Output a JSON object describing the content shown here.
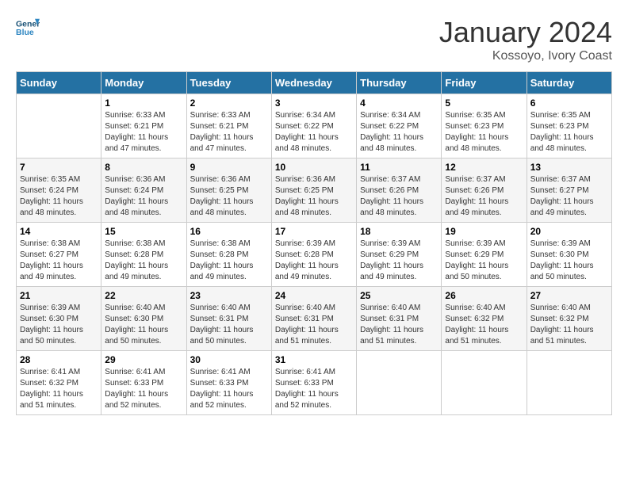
{
  "header": {
    "logo_line1": "General",
    "logo_line2": "Blue",
    "title": "January 2024",
    "subtitle": "Kossoyo, Ivory Coast"
  },
  "weekdays": [
    "Sunday",
    "Monday",
    "Tuesday",
    "Wednesday",
    "Thursday",
    "Friday",
    "Saturday"
  ],
  "weeks": [
    [
      {
        "day": "",
        "sunrise": "",
        "sunset": "",
        "daylight": ""
      },
      {
        "day": "1",
        "sunrise": "Sunrise: 6:33 AM",
        "sunset": "Sunset: 6:21 PM",
        "daylight": "Daylight: 11 hours and 47 minutes."
      },
      {
        "day": "2",
        "sunrise": "Sunrise: 6:33 AM",
        "sunset": "Sunset: 6:21 PM",
        "daylight": "Daylight: 11 hours and 47 minutes."
      },
      {
        "day": "3",
        "sunrise": "Sunrise: 6:34 AM",
        "sunset": "Sunset: 6:22 PM",
        "daylight": "Daylight: 11 hours and 48 minutes."
      },
      {
        "day": "4",
        "sunrise": "Sunrise: 6:34 AM",
        "sunset": "Sunset: 6:22 PM",
        "daylight": "Daylight: 11 hours and 48 minutes."
      },
      {
        "day": "5",
        "sunrise": "Sunrise: 6:35 AM",
        "sunset": "Sunset: 6:23 PM",
        "daylight": "Daylight: 11 hours and 48 minutes."
      },
      {
        "day": "6",
        "sunrise": "Sunrise: 6:35 AM",
        "sunset": "Sunset: 6:23 PM",
        "daylight": "Daylight: 11 hours and 48 minutes."
      }
    ],
    [
      {
        "day": "7",
        "sunrise": "Sunrise: 6:35 AM",
        "sunset": "Sunset: 6:24 PM",
        "daylight": "Daylight: 11 hours and 48 minutes."
      },
      {
        "day": "8",
        "sunrise": "Sunrise: 6:36 AM",
        "sunset": "Sunset: 6:24 PM",
        "daylight": "Daylight: 11 hours and 48 minutes."
      },
      {
        "day": "9",
        "sunrise": "Sunrise: 6:36 AM",
        "sunset": "Sunset: 6:25 PM",
        "daylight": "Daylight: 11 hours and 48 minutes."
      },
      {
        "day": "10",
        "sunrise": "Sunrise: 6:36 AM",
        "sunset": "Sunset: 6:25 PM",
        "daylight": "Daylight: 11 hours and 48 minutes."
      },
      {
        "day": "11",
        "sunrise": "Sunrise: 6:37 AM",
        "sunset": "Sunset: 6:26 PM",
        "daylight": "Daylight: 11 hours and 48 minutes."
      },
      {
        "day": "12",
        "sunrise": "Sunrise: 6:37 AM",
        "sunset": "Sunset: 6:26 PM",
        "daylight": "Daylight: 11 hours and 49 minutes."
      },
      {
        "day": "13",
        "sunrise": "Sunrise: 6:37 AM",
        "sunset": "Sunset: 6:27 PM",
        "daylight": "Daylight: 11 hours and 49 minutes."
      }
    ],
    [
      {
        "day": "14",
        "sunrise": "Sunrise: 6:38 AM",
        "sunset": "Sunset: 6:27 PM",
        "daylight": "Daylight: 11 hours and 49 minutes."
      },
      {
        "day": "15",
        "sunrise": "Sunrise: 6:38 AM",
        "sunset": "Sunset: 6:28 PM",
        "daylight": "Daylight: 11 hours and 49 minutes."
      },
      {
        "day": "16",
        "sunrise": "Sunrise: 6:38 AM",
        "sunset": "Sunset: 6:28 PM",
        "daylight": "Daylight: 11 hours and 49 minutes."
      },
      {
        "day": "17",
        "sunrise": "Sunrise: 6:39 AM",
        "sunset": "Sunset: 6:28 PM",
        "daylight": "Daylight: 11 hours and 49 minutes."
      },
      {
        "day": "18",
        "sunrise": "Sunrise: 6:39 AM",
        "sunset": "Sunset: 6:29 PM",
        "daylight": "Daylight: 11 hours and 49 minutes."
      },
      {
        "day": "19",
        "sunrise": "Sunrise: 6:39 AM",
        "sunset": "Sunset: 6:29 PM",
        "daylight": "Daylight: 11 hours and 50 minutes."
      },
      {
        "day": "20",
        "sunrise": "Sunrise: 6:39 AM",
        "sunset": "Sunset: 6:30 PM",
        "daylight": "Daylight: 11 hours and 50 minutes."
      }
    ],
    [
      {
        "day": "21",
        "sunrise": "Sunrise: 6:39 AM",
        "sunset": "Sunset: 6:30 PM",
        "daylight": "Daylight: 11 hours and 50 minutes."
      },
      {
        "day": "22",
        "sunrise": "Sunrise: 6:40 AM",
        "sunset": "Sunset: 6:30 PM",
        "daylight": "Daylight: 11 hours and 50 minutes."
      },
      {
        "day": "23",
        "sunrise": "Sunrise: 6:40 AM",
        "sunset": "Sunset: 6:31 PM",
        "daylight": "Daylight: 11 hours and 50 minutes."
      },
      {
        "day": "24",
        "sunrise": "Sunrise: 6:40 AM",
        "sunset": "Sunset: 6:31 PM",
        "daylight": "Daylight: 11 hours and 51 minutes."
      },
      {
        "day": "25",
        "sunrise": "Sunrise: 6:40 AM",
        "sunset": "Sunset: 6:31 PM",
        "daylight": "Daylight: 11 hours and 51 minutes."
      },
      {
        "day": "26",
        "sunrise": "Sunrise: 6:40 AM",
        "sunset": "Sunset: 6:32 PM",
        "daylight": "Daylight: 11 hours and 51 minutes."
      },
      {
        "day": "27",
        "sunrise": "Sunrise: 6:40 AM",
        "sunset": "Sunset: 6:32 PM",
        "daylight": "Daylight: 11 hours and 51 minutes."
      }
    ],
    [
      {
        "day": "28",
        "sunrise": "Sunrise: 6:41 AM",
        "sunset": "Sunset: 6:32 PM",
        "daylight": "Daylight: 11 hours and 51 minutes."
      },
      {
        "day": "29",
        "sunrise": "Sunrise: 6:41 AM",
        "sunset": "Sunset: 6:33 PM",
        "daylight": "Daylight: 11 hours and 52 minutes."
      },
      {
        "day": "30",
        "sunrise": "Sunrise: 6:41 AM",
        "sunset": "Sunset: 6:33 PM",
        "daylight": "Daylight: 11 hours and 52 minutes."
      },
      {
        "day": "31",
        "sunrise": "Sunrise: 6:41 AM",
        "sunset": "Sunset: 6:33 PM",
        "daylight": "Daylight: 11 hours and 52 minutes."
      },
      {
        "day": "",
        "sunrise": "",
        "sunset": "",
        "daylight": ""
      },
      {
        "day": "",
        "sunrise": "",
        "sunset": "",
        "daylight": ""
      },
      {
        "day": "",
        "sunrise": "",
        "sunset": "",
        "daylight": ""
      }
    ]
  ]
}
